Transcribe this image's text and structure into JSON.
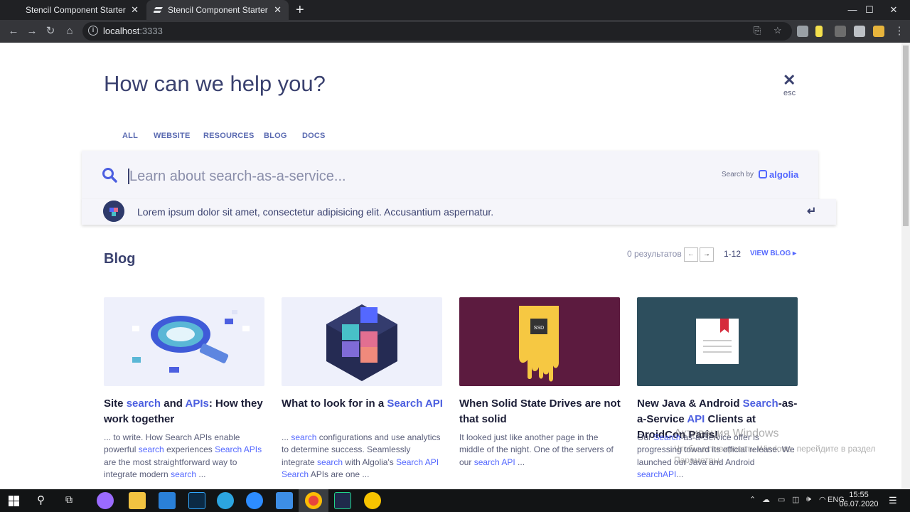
{
  "browser": {
    "tabs": [
      {
        "label": "Stencil Component Starter",
        "close": "✕"
      },
      {
        "label": "Stencil Component Starter",
        "close": "✕"
      }
    ],
    "new_tab": "+",
    "window_controls": {
      "minimize": "—",
      "maximize": "☐",
      "close": "✕"
    },
    "url_host": "localhost",
    "url_port": ":3333"
  },
  "search_panel": {
    "title": "How can we help you?",
    "close_label": "esc",
    "tabs": [
      "ALL",
      "WEBSITE",
      "RESOURCES",
      "BLOG",
      "DOCS"
    ],
    "placeholder": "Learn about search-as-a-service...",
    "search_by": "Search by",
    "algolia": "algolia",
    "suggestion": "Lorem ipsum dolor sit amet, consectetur adipisicing elit. Accusantium aspernatur."
  },
  "blog": {
    "heading": "Blog",
    "results": "0 результатов",
    "prev": "←",
    "next": "→",
    "range": "1-12",
    "view_blog": "VIEW BLOG ▸",
    "cards": [
      {
        "title": [
          "Site ",
          "search",
          " and ",
          "APIs",
          ": How they work together"
        ],
        "excerpt": [
          "... to write.   How Search APIs enable powerful ",
          "search",
          " experiences ",
          "Search APIs",
          " are the most straightforward way to integrate modern ",
          "search",
          " ..."
        ]
      },
      {
        "title": [
          "What to look for in a ",
          "Search API"
        ],
        "excerpt": [
          "... ",
          "search",
          " configurations and use analytics to determine success.   Seamlessly integrate ",
          "search",
          " with Algolia's ",
          "Search API",
          " ",
          "Search",
          " APIs are one ..."
        ]
      },
      {
        "title": [
          "When Solid State Drives are not that solid"
        ],
        "excerpt": [
          "It looked just like another page in the middle of the night. One of the servers of our ",
          "search API",
          " ..."
        ]
      },
      {
        "title": [
          "New Java & Android ",
          "Search",
          "-as-a-Service ",
          "API",
          " Clients at DroidCon Paris!"
        ],
        "excerpt": [
          "Our ",
          "Search",
          "-as-a-Service offer is progressing toward its official release. We launched our Java and Android ",
          "searchAPI",
          "..."
        ]
      }
    ],
    "card_images": [
      {
        "bg": "#eef0fb"
      },
      {
        "bg": "#eef0fb"
      },
      {
        "bg": "#5c1b3f"
      },
      {
        "bg": "#2d4e5d"
      }
    ]
  },
  "watermark": {
    "line1": "Активация Windows",
    "line2": "Чтобы активировать Windows, перейдите в раздел",
    "line3": "Параметры."
  },
  "taskbar": {
    "language": "ENG",
    "time": "15:55",
    "date": "06.07.2020"
  },
  "colors": {
    "accent": "#5468ff",
    "heading": "#3a416f"
  }
}
